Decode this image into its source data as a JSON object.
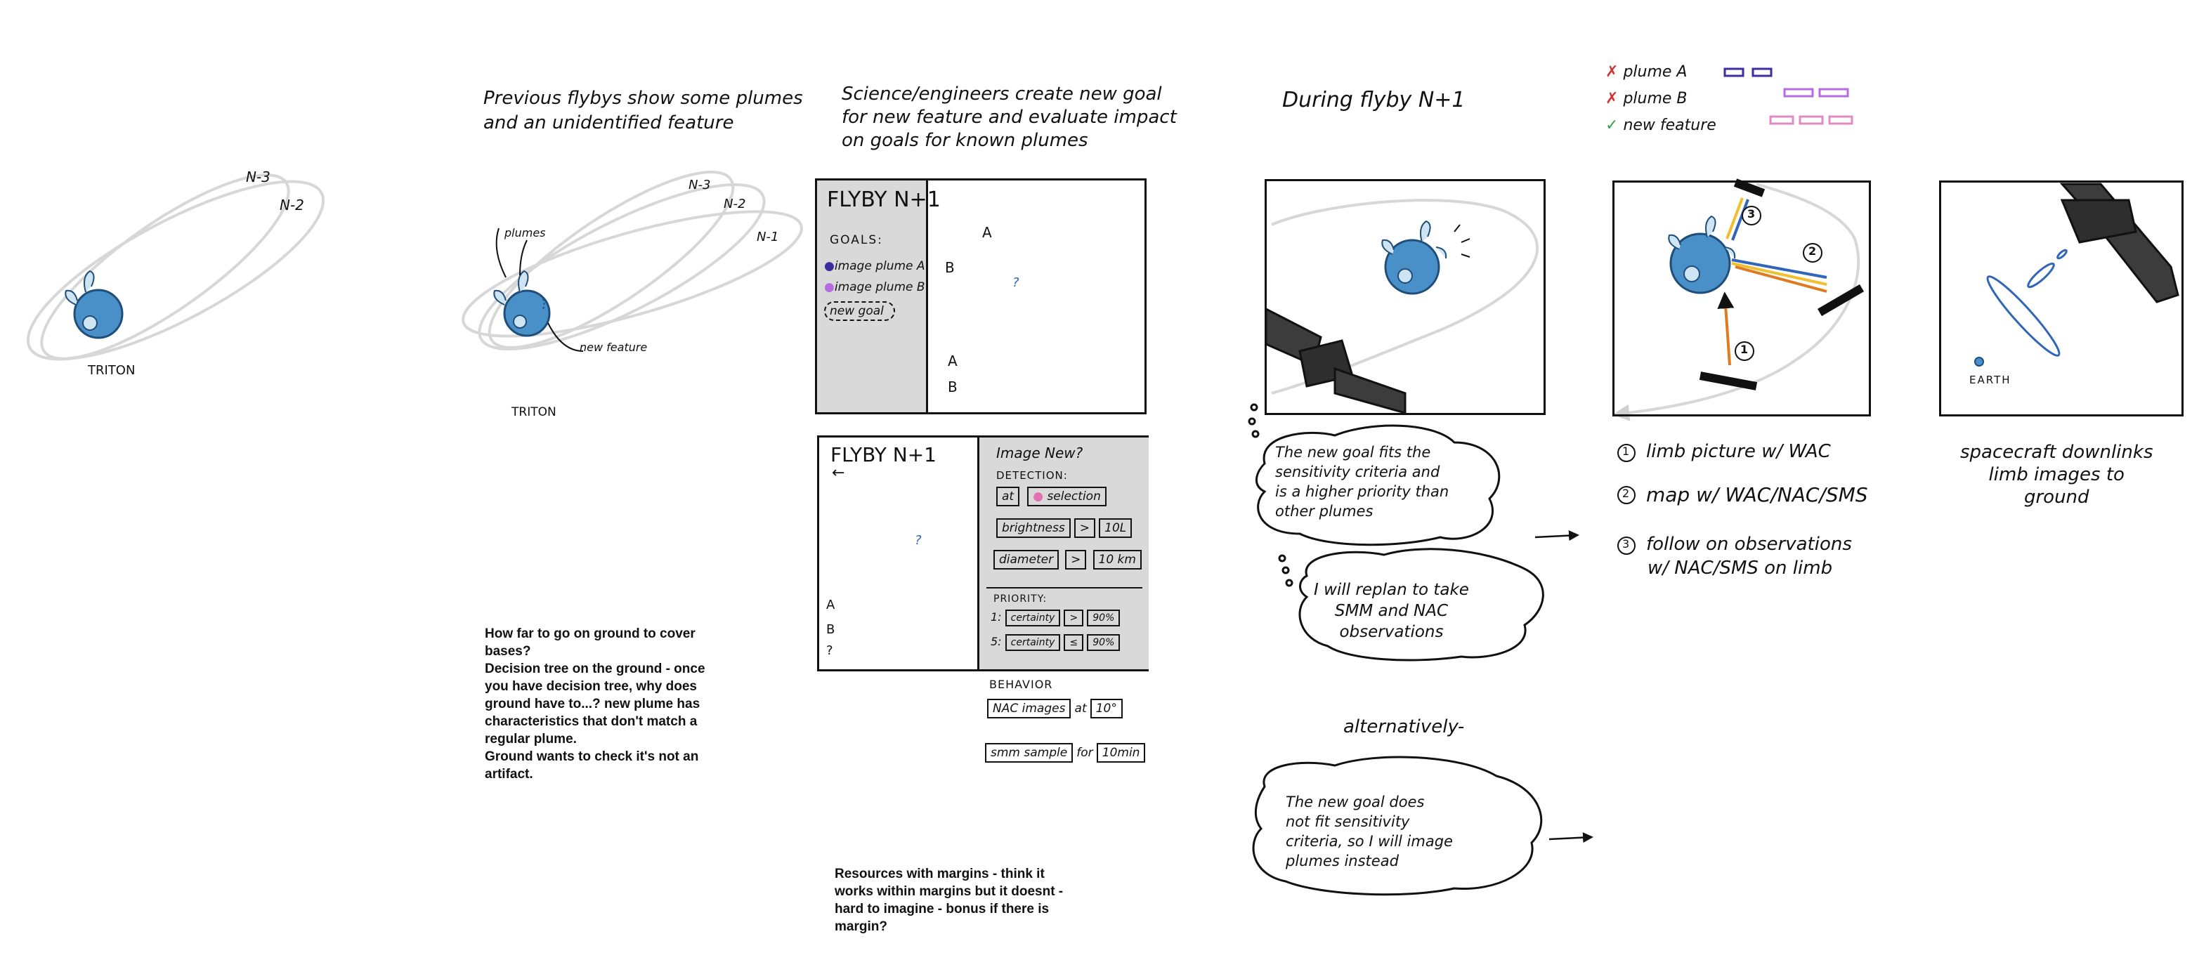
{
  "panel1": {
    "labels": [
      "N-3",
      "N-2"
    ],
    "moon": "TRITON"
  },
  "panel2": {
    "title": [
      "Previous flybys show some plumes",
      "and an unidentified feature"
    ],
    "labels": [
      "N-3",
      "N-2",
      "N-1"
    ],
    "plumes": "plumes",
    "new_feature": "new feature",
    "moon": "TRITON",
    "notes": [
      "How far to go on ground to cover",
      "bases?",
      "Decision tree on the ground - once",
      "you have decision tree, why does",
      "ground have to...? new plume has",
      "characteristics that don't match a",
      "regular plume.",
      "Ground wants to check it's not an",
      "artifact."
    ]
  },
  "panel3": {
    "title": [
      "Science/engineers create new goal",
      "for new feature and evaluate impact",
      "on goals for known plumes"
    ],
    "top": {
      "header": "FLYBY N+1",
      "goals_label": "GOALS:",
      "goal_a": "image plume A",
      "goal_b": "image plume B",
      "new_goal": "new goal",
      "plume_a": "A",
      "plume_b": "B",
      "q": "?"
    },
    "bottom": {
      "header": "FLYBY N+1",
      "back": "←",
      "image_new": "Image New?",
      "detection": "DETECTION:",
      "at": "at",
      "selection": "selection",
      "brightness": "brightness",
      "gt": ">",
      "brightness_val": "10L",
      "diameter": "diameter",
      "diameter_val": "10 km",
      "priority": "PRIORITY:",
      "p1": "1:",
      "p5": "5:",
      "certainty": "certainty",
      "le": "≤",
      "c1_val": "90%",
      "c5_val": "90%",
      "series": [
        "A",
        "B",
        "?"
      ]
    },
    "behavior": "BEHAVIOR",
    "nac": "NAC images",
    "at": "at",
    "nac_val": "10°",
    "smm": "smm sample",
    "for": "for",
    "smm_val": "10min",
    "notes": [
      "Resources with margins - think it",
      "works within margins but it doesnt -",
      "hard to imagine - bonus if there is",
      "margin?"
    ]
  },
  "panel4": {
    "title": "During flyby N+1",
    "bubble1": [
      "The new goal fits the",
      "sensitivity criteria and",
      "is a higher priority than",
      "other plumes"
    ],
    "bubble2": [
      "I will replan to take",
      "SMM and NAC",
      "observations"
    ],
    "alt": "alternatively-",
    "bubble3": [
      "The new goal does",
      "not fit sensitivity",
      "criteria, so I will image",
      "plumes instead"
    ],
    "arrow": "→"
  },
  "panel5": {
    "legend": [
      {
        "mark": "✗",
        "label": "plume A",
        "color": "#d33333"
      },
      {
        "mark": "✗",
        "label": "plume B",
        "color": "#d33333"
      },
      {
        "mark": "✓",
        "label": "new feature",
        "color": "#3aa04a"
      }
    ],
    "numbers": [
      "1",
      "2",
      "3"
    ],
    "steps": [
      {
        "n": "1",
        "text": "limb picture w/ WAC"
      },
      {
        "n": "2",
        "text": "map w/ WAC/NAC/SMS"
      },
      {
        "n": "3",
        "text": "follow on observations"
      }
    ],
    "step3_cont": "w/ NAC/SMS on limb"
  },
  "panel6": {
    "earth": "EARTH",
    "caption": [
      "spacecraft downlinks",
      "limb images to",
      "ground"
    ]
  }
}
